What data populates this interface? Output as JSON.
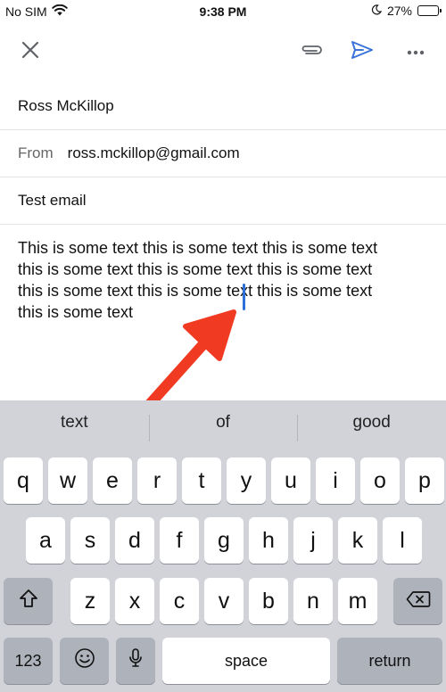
{
  "status_bar": {
    "carrier": "No SIM",
    "time": "9:38 PM",
    "battery": "27%",
    "battery_level": 0.27
  },
  "toolbar": {
    "close_icon": "close-icon",
    "attach_icon": "paperclip-icon",
    "send_icon": "send-icon",
    "more_icon": "more-horizontal-icon",
    "send_color": "#3a73d9"
  },
  "compose": {
    "to": "Ross McKillop",
    "from_label": "From",
    "from_value": "ross.mckillop@gmail.com",
    "subject": "Test email",
    "body_lines": [
      "This is some text this is some text this is some text",
      "this is some text this is some text this is some text",
      "this is some text this is some text this is some text",
      "this is some text"
    ]
  },
  "annotation": {
    "arrow_color": "#f03a22"
  },
  "keyboard": {
    "suggestions": [
      "text",
      "of",
      "good"
    ],
    "row1": [
      "q",
      "w",
      "e",
      "r",
      "t",
      "y",
      "u",
      "i",
      "o",
      "p"
    ],
    "row2": [
      "a",
      "s",
      "d",
      "f",
      "g",
      "h",
      "j",
      "k",
      "l"
    ],
    "row3": [
      "z",
      "x",
      "c",
      "v",
      "b",
      "n",
      "m"
    ],
    "numbers_key": "123",
    "space_key": "space",
    "return_key": "return",
    "icons": {
      "shift": "shift-icon",
      "delete": "backspace-icon",
      "emoji": "emoji-icon",
      "mic": "microphone-icon"
    }
  }
}
